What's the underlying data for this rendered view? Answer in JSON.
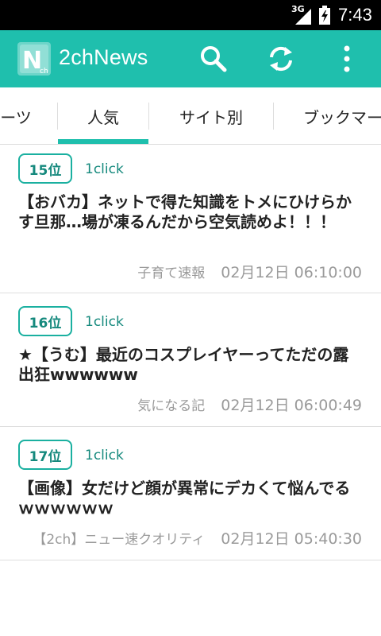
{
  "status_bar": {
    "network": "3G",
    "time": "7:43"
  },
  "app_bar": {
    "logo_text": "N",
    "logo_subtext": "ch",
    "title": "2chNews",
    "icons": [
      "search-icon",
      "refresh-icon",
      "more-vert-icon"
    ]
  },
  "tabs": [
    {
      "label": "ーツ"
    },
    {
      "label": "人気",
      "selected": true
    },
    {
      "label": "サイト別"
    },
    {
      "label": "ブックマー"
    }
  ],
  "colors": {
    "primary": "#1fbfad",
    "accent_text": "#15897d",
    "status_bar": "#000000"
  },
  "items": [
    {
      "rank": "15位",
      "clicks": "1click",
      "title": "【おバカ】ネットで得た知識をトメにひけらかす旦那…場が凍るんだから空気読めよ！！！",
      "site": "子育て速報",
      "date": "02月12日 06:10:00"
    },
    {
      "rank": "16位",
      "clicks": "1click",
      "title": "★【うむ】最近のコスプレイヤーってただの露出狂wwwwww",
      "site": "気になる記",
      "date": "02月12日 06:00:49"
    },
    {
      "rank": "17位",
      "clicks": "1click",
      "title": "【画像】女だけど顔が異常にデカくて悩んでるｗｗｗｗｗｗ",
      "site": "【2ch】ニュー速クオリティ",
      "date": "02月12日 05:40:30"
    }
  ]
}
